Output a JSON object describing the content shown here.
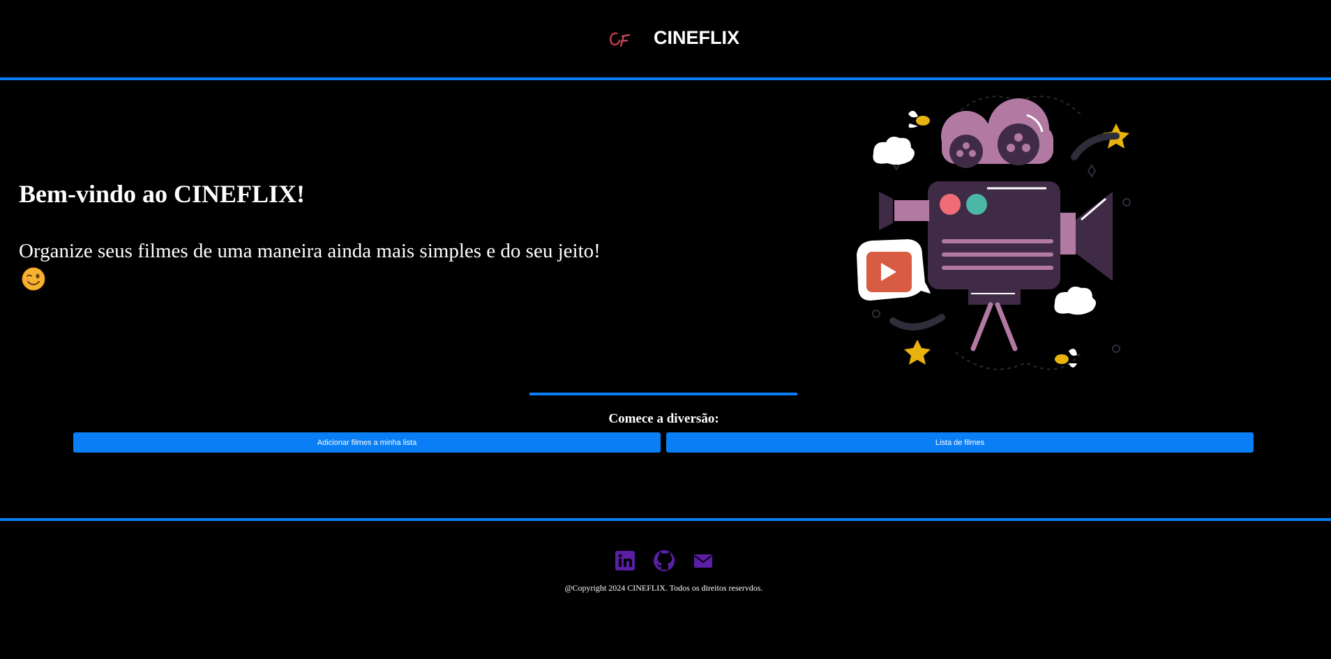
{
  "header": {
    "logo_icon": "cineflix-cf-logo-icon",
    "brand": "CINEFLIX"
  },
  "hero": {
    "title": "Bem-vindo ao CINEFLIX!",
    "subtitle": "Organize seus filmes de uma maneira ainda mais simples e do seu jeito!",
    "emoji_icon": "winking-face-icon",
    "illustration": "film-camera-illustration"
  },
  "cta": {
    "label": "Comece a diversão:",
    "add_button": "Adicionar filmes a minha lista",
    "list_button": "Lista de filmes"
  },
  "footer": {
    "social": [
      {
        "icon": "linkedin-icon"
      },
      {
        "icon": "github-icon"
      },
      {
        "icon": "mail-icon"
      }
    ],
    "copyright": "@Copyright 2024 CINEFLIX. Todos os direitos reservdos."
  },
  "colors": {
    "background": "#000000",
    "accent": "#0a7ff5",
    "social_icons": "#5a1fa6",
    "logo": "#c0384b"
  }
}
